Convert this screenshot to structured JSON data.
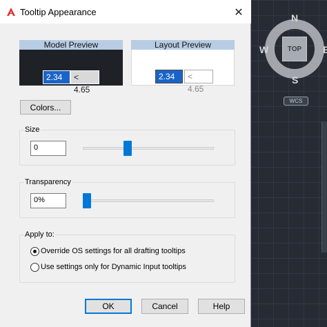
{
  "window": {
    "title": "Tooltip Appearance"
  },
  "previews": {
    "model": {
      "label": "Model Preview",
      "value": "2.34",
      "angle": "< 4.65"
    },
    "layout": {
      "label": "Layout Preview",
      "value": "2.34",
      "angle": "< 4.65"
    }
  },
  "colors_button": "Colors...",
  "size": {
    "label": "Size",
    "value": "0",
    "slider_fraction": 0.33
  },
  "transparency": {
    "label": "Transparency",
    "value": "0%",
    "slider_fraction": 0.0
  },
  "apply_to": {
    "label": "Apply to:",
    "options": [
      {
        "label": "Override OS settings for all drafting tooltips",
        "selected": true
      },
      {
        "label": "Use settings only for Dynamic Input tooltips",
        "selected": false
      }
    ]
  },
  "buttons": {
    "ok": "OK",
    "cancel": "Cancel",
    "help": "Help"
  },
  "viewcube": {
    "face": "TOP",
    "north": "N",
    "south": "S",
    "east": "E",
    "west": "W",
    "wcs": "WCS"
  },
  "colors": {
    "accent": "#0078d7",
    "preview_header": "#b8cce4",
    "model_bg": "#1e2126"
  }
}
